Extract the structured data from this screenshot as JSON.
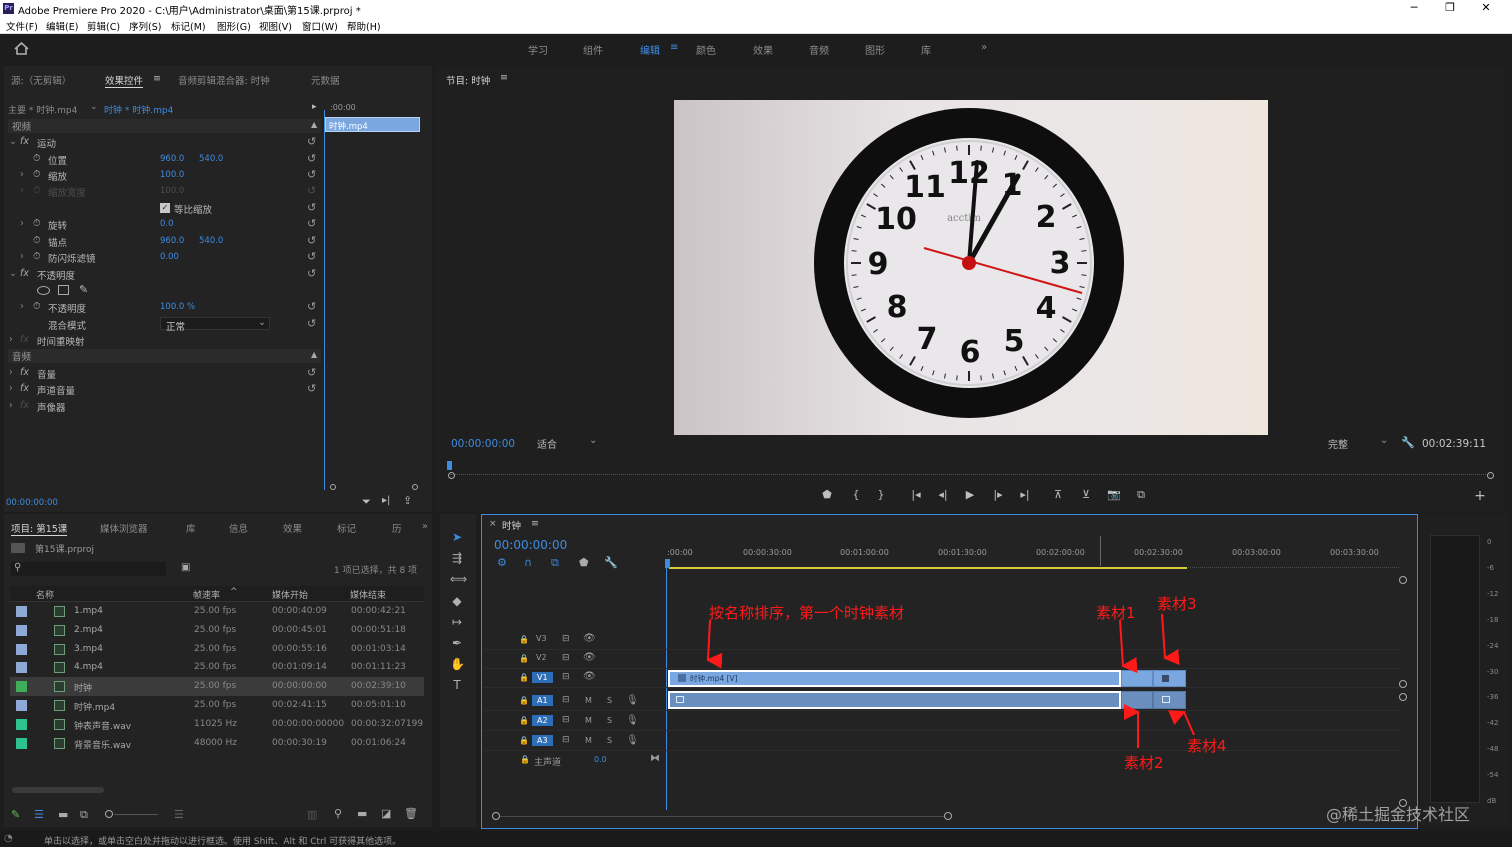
{
  "window": {
    "title": "Adobe Premiere Pro 2020 - C:\\用户\\Administrator\\桌面\\第15课.prproj *",
    "app_icon": "Pr"
  },
  "menu": [
    "文件(F)",
    "编辑(E)",
    "剪辑(C)",
    "序列(S)",
    "标记(M)",
    "图形(G)",
    "视图(V)",
    "窗口(W)",
    "帮助(H)"
  ],
  "workspaces": [
    "学习",
    "组件",
    "编辑",
    "颜色",
    "效果",
    "音频",
    "图形",
    "库"
  ],
  "workspace_more": "»",
  "effect_panel": {
    "tabs": [
      "源:（无剪辑）",
      "效果控件",
      "音频剪辑混合器: 时钟",
      "元数据"
    ],
    "tab_menu": "≡",
    "master_clip": "主要 * 时钟.mp4",
    "seq_clip": "时钟 * 时钟.mp4",
    "mini_time": ":00:00",
    "mini_clip": "时钟.mp4",
    "video_section": "视频",
    "audio_section": "音频",
    "motion": "运动",
    "position": {
      "label": "位置",
      "x": "960.0",
      "y": "540.0"
    },
    "scale": {
      "label": "缩放",
      "v": "100.0"
    },
    "scale_width": {
      "label": "缩放宽度",
      "v": "100.0"
    },
    "uniform": "等比缩放",
    "rotation": {
      "label": "旋转",
      "v": "0.0"
    },
    "anchor": {
      "label": "锚点",
      "x": "960.0",
      "y": "540.0"
    },
    "flicker": {
      "label": "防闪烁滤镜",
      "v": "0.00"
    },
    "opacity_group": "不透明度",
    "opacity": {
      "label": "不透明度",
      "v": "100.0 %"
    },
    "blend": {
      "label": "混合模式",
      "v": "正常"
    },
    "time_remap": "时间重映射",
    "volume": "音量",
    "channel_volume": "声道音量",
    "panner": "声像器",
    "timecode": "00:00:00:00"
  },
  "program": {
    "title": "节目: 时钟",
    "timecode": "00:00:00:00",
    "fit": "适合",
    "quality": "完整",
    "duration": "00:02:39:11",
    "clock_numbers": [
      "12",
      "1",
      "2",
      "3",
      "4",
      "5",
      "6",
      "7",
      "8",
      "9",
      "10",
      "11"
    ],
    "clock_brand": "acctim",
    "add_button": "+"
  },
  "project": {
    "tabs": [
      "项目: 第15课",
      "媒体浏览器",
      "库",
      "信息",
      "效果",
      "标记",
      "历"
    ],
    "more": "»",
    "file": "第15课.prproj",
    "selection": "1 项已选择，共 8 项",
    "columns": [
      "名称",
      "帧速率",
      "媒体开始",
      "媒体结束"
    ],
    "rows": [
      {
        "name": "1.mp4",
        "rate": "25.00 fps",
        "start": "00:00:40:09",
        "end": "00:00:42:21",
        "color": "#8fa9d6"
      },
      {
        "name": "2.mp4",
        "rate": "25.00 fps",
        "start": "00:00:45:01",
        "end": "00:00:51:18",
        "color": "#8fa9d6"
      },
      {
        "name": "3.mp4",
        "rate": "25.00 fps",
        "start": "00:00:55:16",
        "end": "00:01:03:14",
        "color": "#8fa9d6"
      },
      {
        "name": "4.mp4",
        "rate": "25.00 fps",
        "start": "00:01:09:14",
        "end": "00:01:11:23",
        "color": "#8fa9d6"
      },
      {
        "name": "时钟",
        "rate": "25.00 fps",
        "start": "00:00:00:00",
        "end": "00:02:39:10",
        "color": "#3fae5a"
      },
      {
        "name": "时钟.mp4",
        "rate": "25.00 fps",
        "start": "00:02:41:15",
        "end": "00:05:01:10",
        "color": "#8fa9d6"
      },
      {
        "name": "钟表声音.wav",
        "rate": "11025 Hz",
        "start": "00:00:00:00000",
        "end": "00:00:32:07199",
        "color": "#2ec38e"
      },
      {
        "name": "背景音乐.wav",
        "rate": "48000 Hz",
        "start": "00:00:30:19",
        "end": "00:01:06:24",
        "color": "#2ec38e"
      }
    ]
  },
  "timeline": {
    "title": "时钟",
    "timecode": "00:00:00:00",
    "ruler": [
      ":00:00",
      "00:00:30:00",
      "00:01:00:00",
      "00:01:30:00",
      "00:02:00:00",
      "00:02:30:00",
      "00:03:00:00",
      "00:03:30:00"
    ],
    "video_tracks": [
      "V3",
      "V2",
      "V1"
    ],
    "audio_tracks": [
      "A1",
      "A2",
      "A3"
    ],
    "master": "主声道",
    "master_val": "0.0",
    "clip_label": "时钟.mp4 [V]",
    "ms": [
      "M",
      "S"
    ]
  },
  "annotations": {
    "a1": "按名称排序，第一个时钟素材",
    "a2": "素材1",
    "a3": "素材3",
    "a4": "素材2",
    "a5": "素材4"
  },
  "meter": [
    "0",
    "-6",
    "-12",
    "-18",
    "-24",
    "-30",
    "-36",
    "-42",
    "-48",
    "-54",
    "dB"
  ],
  "status": "单击以选择，或单击空白处并拖动以进行框选。使用 Shift、Alt 和 Ctrl 可获得其他选项。",
  "watermark": "@稀土掘金技术社区"
}
